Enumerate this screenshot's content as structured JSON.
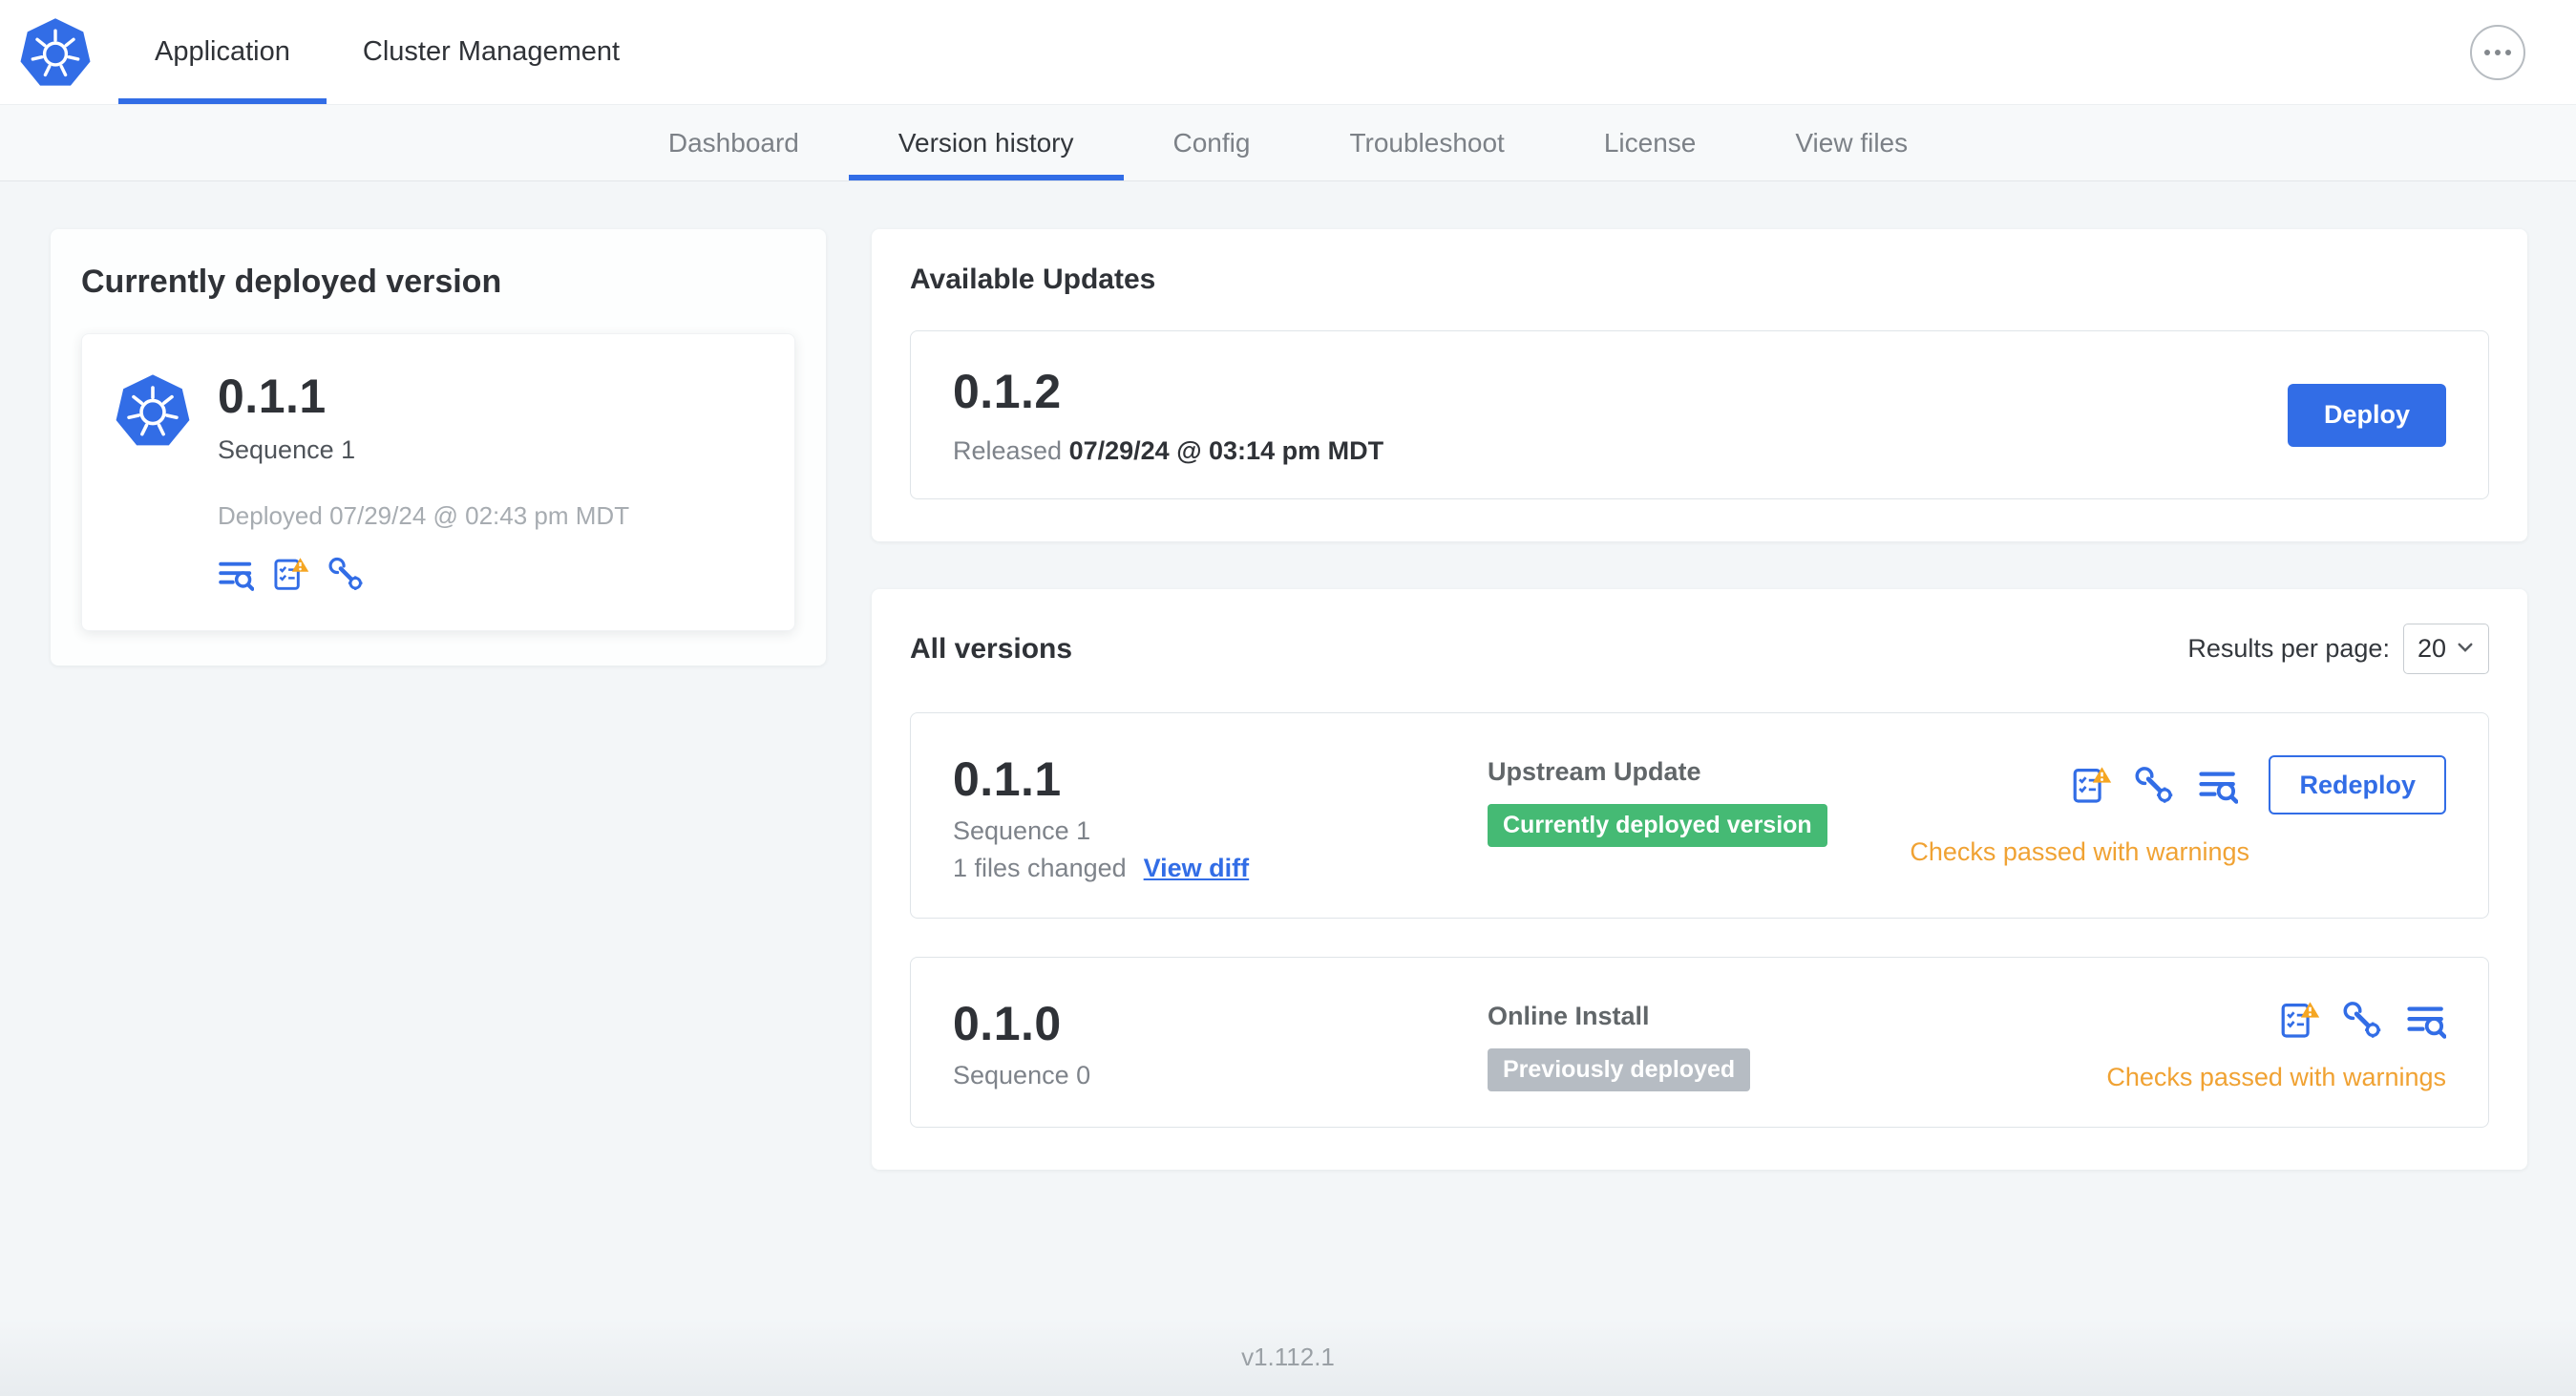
{
  "topnav": {
    "tabs": [
      {
        "label": "Application",
        "active": true
      },
      {
        "label": "Cluster Management",
        "active": false
      }
    ],
    "more_icon": "ellipsis-icon"
  },
  "subnav": {
    "items": [
      {
        "label": "Dashboard",
        "active": false
      },
      {
        "label": "Version history",
        "active": true
      },
      {
        "label": "Config",
        "active": false
      },
      {
        "label": "Troubleshoot",
        "active": false
      },
      {
        "label": "License",
        "active": false
      },
      {
        "label": "View files",
        "active": false
      }
    ]
  },
  "current_version": {
    "title": "Currently deployed version",
    "version": "0.1.1",
    "sequence": "Sequence 1",
    "deployed": "Deployed 07/29/24 @ 02:43 pm MDT",
    "icons": [
      "deploy-logs-icon",
      "preflight-checks-warning-icon",
      "config-tools-icon"
    ]
  },
  "available_updates": {
    "title": "Available Updates",
    "version": "0.1.2",
    "released_prefix": "Released",
    "released_date": "07/29/24 @ 03:14 pm MDT",
    "deploy_label": "Deploy"
  },
  "all_versions": {
    "title": "All versions",
    "results_per_page_label": "Results per page:",
    "results_per_page_value": "20",
    "rows": [
      {
        "version": "0.1.1",
        "sequence": "Sequence 1",
        "files_changed": "1 files changed",
        "view_diff": "View diff",
        "source": "Upstream Update",
        "badge": "Currently deployed version",
        "badge_type": "green",
        "action": "Redeploy",
        "checks": "Checks passed with warnings",
        "icons": [
          "preflight-checks-warning-icon",
          "config-tools-icon",
          "deploy-logs-icon"
        ]
      },
      {
        "version": "0.1.0",
        "sequence": "Sequence 0",
        "source": "Online Install",
        "badge": "Previously deployed",
        "badge_type": "gray",
        "checks": "Checks passed with warnings",
        "icons": [
          "preflight-checks-warning-icon",
          "config-tools-icon",
          "deploy-logs-icon"
        ]
      }
    ]
  },
  "footer": {
    "version_label": "v1.112.1"
  },
  "colors": {
    "accent_blue": "#326de6",
    "success_badge": "#45ba74",
    "muted_badge": "#b6bcc3",
    "warning_text": "#f0a233",
    "warning_triangle": "#f5a623"
  }
}
